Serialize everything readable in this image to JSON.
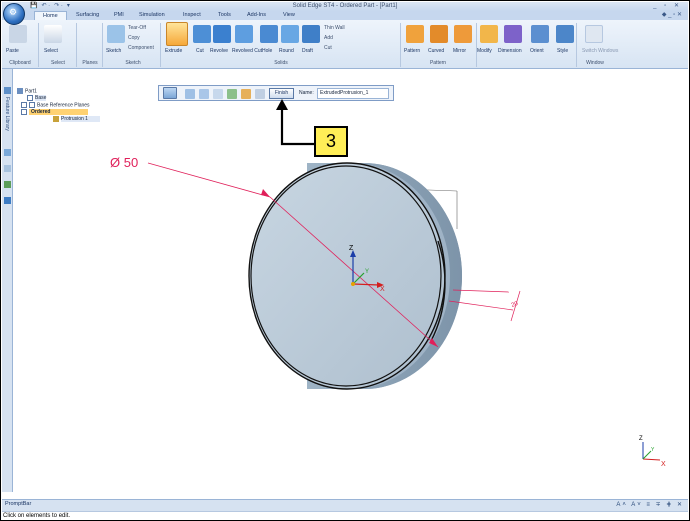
{
  "window": {
    "title": "Solid Edge ST4 - Ordered Part - [Part1]",
    "controls": "_ ▫ ✕",
    "doc_controls": "◆ _ ▫ ✕"
  },
  "quick_access": [
    "💾",
    "↶ ·",
    "↷ ·",
    "▾"
  ],
  "tabs": [
    "Home",
    "Surfacing",
    "PMI",
    "Simulation",
    "Inspect",
    "Tools",
    "Add-Ins",
    "View"
  ],
  "ribbon": {
    "groups": {
      "clipboard": "Clipboard",
      "select": "Select",
      "planes": "Planes",
      "sketch": "Sketch",
      "solids": "Solids",
      "pattern": "Pattern",
      "window": "Window"
    },
    "buttons": {
      "paste": "Paste",
      "select": "Select",
      "sketch": "Sketch",
      "extrude": "Extrude",
      "cut": "Cut",
      "revolve": "Revolve",
      "revolved_cut": "Revolved\nCut",
      "hole": "Hole",
      "round": "Round",
      "draft": "Draft",
      "pattern": "Pattern",
      "curved": "Curved",
      "mirror": "Mirror",
      "modify": "Modify",
      "dimension": "Dimension",
      "orient": "Orient",
      "style": "Style",
      "switch_windows": "Switch\nWindows"
    },
    "small": {
      "tear_off": "Tear-Off",
      "copy": "Copy",
      "component": "Component",
      "thin_wall": "Thin Wall",
      "add": "Add",
      "cut": "Cut"
    }
  },
  "left_strip": {
    "library_label": "Feature Library"
  },
  "tree": {
    "root": "Part1",
    "base": "Base",
    "base_ref_planes": "Base Reference Planes",
    "ordered": "Ordered",
    "protrusion": "Protrusion 1"
  },
  "command_bar": {
    "finish": "Finish",
    "name_label": "Name:",
    "name_value": "ExtrudedProtrusion_1"
  },
  "callout": {
    "number": "3"
  },
  "dimension": {
    "diameter": "Ø 50",
    "depth": "20"
  },
  "triad": {
    "x": "X",
    "y": "Y",
    "z": "Z"
  },
  "prompt_bar": {
    "title": "PromptBar",
    "message": "Click on elements to edit.",
    "controls": "A˄ A˅ ≡ ∓ ⋕ ✕"
  },
  "colors": {
    "ribbon_bg": "#dbe6f4",
    "dimension": "#e0205a",
    "callout": "#ffee57",
    "part_fill": "#b8c9d8"
  }
}
